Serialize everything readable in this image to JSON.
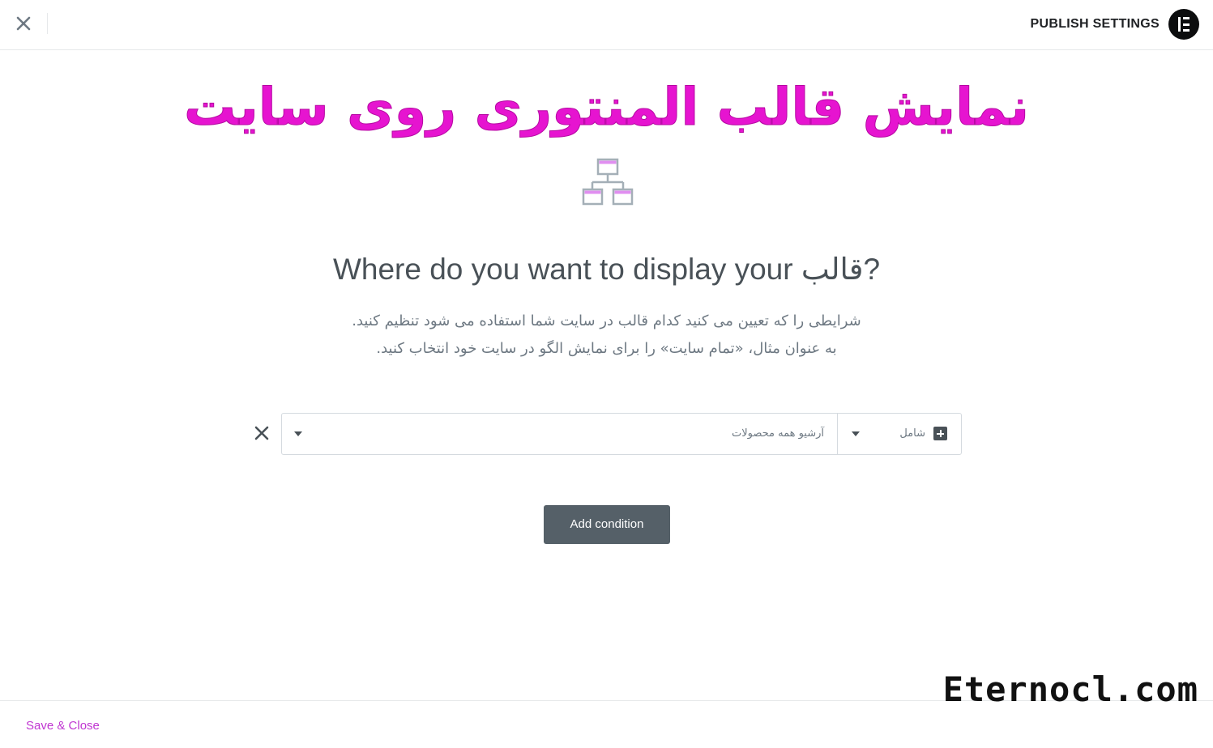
{
  "header": {
    "title": "PUBLISH SETTINGS",
    "close_icon": "close-icon",
    "logo_icon": "elementor-logo-icon"
  },
  "banner": {
    "text": "نمایش قالب المنتوری روی سایت",
    "color": "#e614d0"
  },
  "main": {
    "icon": "sitemap-icon",
    "heading_prefix": "Where do you want to display your ",
    "heading_word": "قالب",
    "heading_suffix": "?",
    "description_line1": "شرایطی را که تعیین می کنید کدام قالب در سایت شما استفاده می شود تنظیم کنید.",
    "description_line2": "به عنوان مثال، «تمام سایت» را برای نمایش الگو در سایت خود انتخاب کنید."
  },
  "condition": {
    "type_label": "شامل",
    "value_label": "آرشیو همه محصولات"
  },
  "add_condition_label": "Add condition",
  "footer": {
    "save_close_label": "Save & Close",
    "link_color": "#c036d1"
  },
  "watermark": "Eternocl.com",
  "colors": {
    "button_bg": "#556068",
    "text": "#495157",
    "muted": "#6d7882"
  }
}
